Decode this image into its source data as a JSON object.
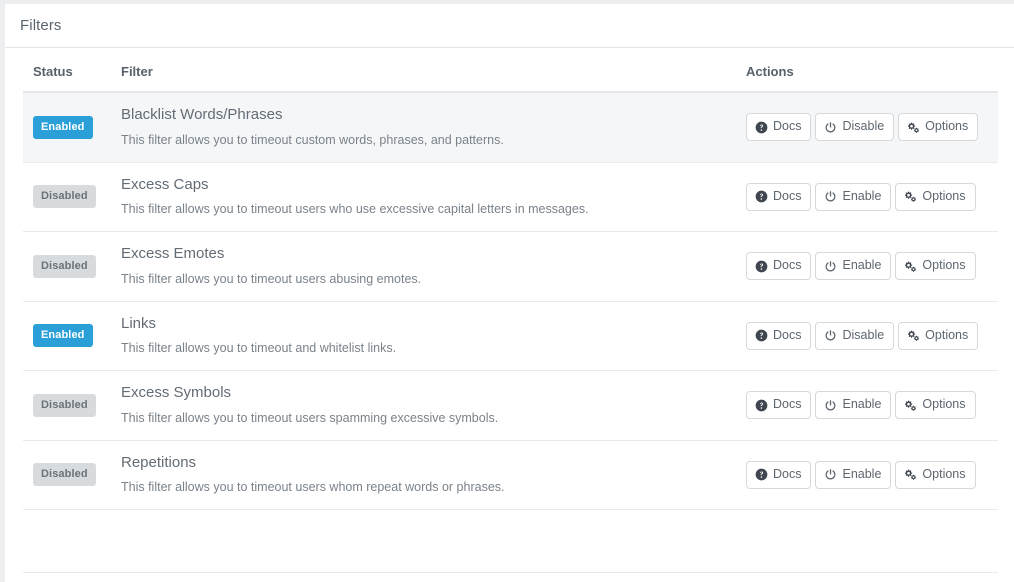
{
  "panel": {
    "title": "Filters"
  },
  "table": {
    "headers": {
      "status": "Status",
      "filter": "Filter",
      "actions": "Actions"
    },
    "buttons": {
      "docs": "Docs",
      "enable": "Enable",
      "disable": "Disable",
      "options": "Options"
    },
    "status_labels": {
      "enabled": "Enabled",
      "disabled": "Disabled"
    },
    "icons": {
      "docs": "question-circle-icon",
      "toggle": "power-icon",
      "options": "cogs-icon"
    },
    "rows": [
      {
        "status": "Enabled",
        "name": "Blacklist Words/Phrases",
        "description": "This filter allows you to timeout custom words, phrases, and patterns.",
        "docs_label": "Docs",
        "toggle_label": "Disable",
        "options_label": "Options",
        "highlighted": true
      },
      {
        "status": "Disabled",
        "name": "Excess Caps",
        "description": "This filter allows you to timeout users who use excessive capital letters in messages.",
        "docs_label": "Docs",
        "toggle_label": "Enable",
        "options_label": "Options",
        "highlighted": false
      },
      {
        "status": "Disabled",
        "name": "Excess Emotes",
        "description": "This filter allows you to timeout users abusing emotes.",
        "docs_label": "Docs",
        "toggle_label": "Enable",
        "options_label": "Options",
        "highlighted": false
      },
      {
        "status": "Enabled",
        "name": "Links",
        "description": "This filter allows you to timeout and whitelist links.",
        "docs_label": "Docs",
        "toggle_label": "Disable",
        "options_label": "Options",
        "highlighted": false
      },
      {
        "status": "Disabled",
        "name": "Excess Symbols",
        "description": "This filter allows you to timeout users spamming excessive symbols.",
        "docs_label": "Docs",
        "toggle_label": "Enable",
        "options_label": "Options",
        "highlighted": false
      },
      {
        "status": "Disabled",
        "name": "Repetitions",
        "description": "This filter allows you to timeout users whom repeat words or phrases.",
        "docs_label": "Docs",
        "toggle_label": "Enable",
        "options_label": "Options",
        "highlighted": false
      }
    ]
  },
  "colors": {
    "badge_enabled_bg": "#2a9fd8",
    "badge_disabled_bg": "#d8dbdd",
    "panel_bg": "#ffffff",
    "row_highlight_bg": "#f5f6f7",
    "border": "#e8eaec",
    "text_title": "#636c75",
    "text_muted": "#7a828a"
  }
}
